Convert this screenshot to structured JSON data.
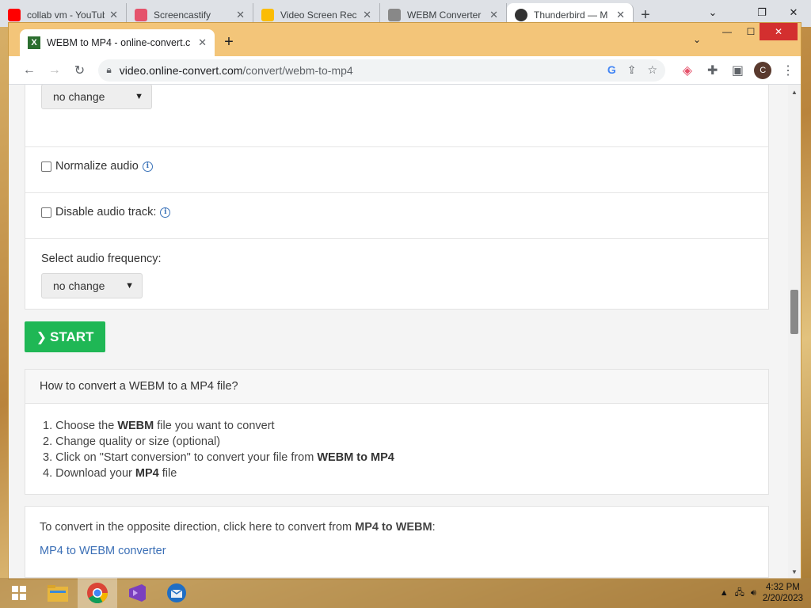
{
  "outer_tabs": [
    {
      "title": "collab vm - YouTube",
      "icon": "youtube-icon",
      "color": "#ff0000"
    },
    {
      "title": "Screencastify",
      "icon": "screencastify-icon",
      "color": "#e5526b"
    },
    {
      "title": "Video Screen Rec",
      "icon": "drive-icon",
      "color": "#fbbc04"
    },
    {
      "title": "WEBM Converter",
      "icon": "cloud-icon",
      "color": "#555555"
    },
    {
      "title": "Thunderbird — M",
      "icon": "github-icon",
      "color": "#333333"
    }
  ],
  "browser": {
    "tab_title": "WEBM to MP4 - online-convert.c",
    "url_host": "video.online-convert.com",
    "url_path": "/convert/webm-to-mp4",
    "avatar_letter": "C"
  },
  "settings": {
    "top_select_value": "no change",
    "normalize_audio_label": "Normalize audio",
    "disable_audio_label": "Disable audio track:",
    "audio_freq_label": "Select audio frequency:",
    "audio_freq_value": "no change"
  },
  "start_label": "START",
  "howto": {
    "title": "How to convert a WEBM to a MP4 file?",
    "steps": [
      {
        "num": "1.",
        "pre": "Choose the ",
        "bold": "WEBM",
        "post": " file you want to convert"
      },
      {
        "num": "2.",
        "pre": "Change quality or size (optional)",
        "bold": "",
        "post": ""
      },
      {
        "num": "3.",
        "pre": "Click on \"Start conversion\" to convert your file from ",
        "bold": "WEBM to MP4",
        "post": ""
      },
      {
        "num": "4.",
        "pre": "Download your ",
        "bold": "MP4",
        "post": " file"
      }
    ]
  },
  "opposite": {
    "text_pre": "To convert in the opposite direction, click here to convert from ",
    "text_bold": "MP4 to WEBM",
    "text_post": ":",
    "link": "MP4 to WEBM converter"
  },
  "taskbar": {
    "time": "4:32 PM",
    "date": "2/20/2023"
  }
}
